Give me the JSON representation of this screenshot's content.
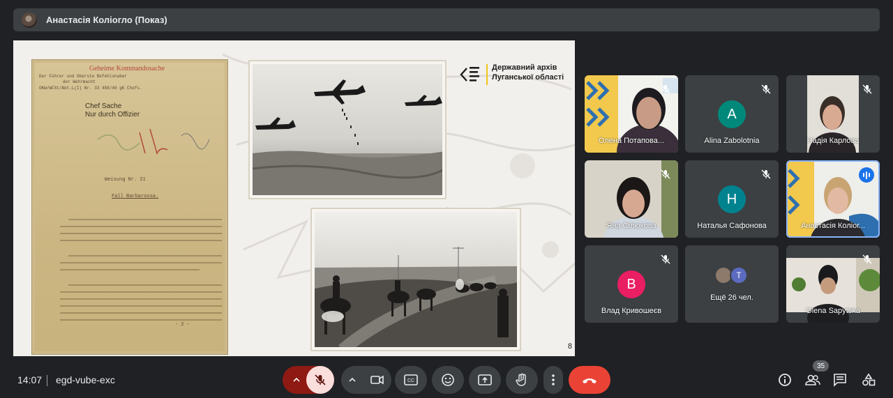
{
  "presenter": {
    "name": "Анастасія Коліогло (Показ)"
  },
  "slide": {
    "logo_line1": "Державний архів",
    "logo_line2": "Луганської області",
    "page_number": "8",
    "doc": {
      "stamp": "Geheime Kommandosache",
      "header_lines": [
        "Der Führer und Oberste Befehlshaber",
        "der Wehrmacht",
        "OKW/WFSt/Abt.L(I) Nr. 33 408/40 gK Chefs."
      ],
      "chef_line1": "Chef Sache",
      "chef_line2": "Nur durch Offizier",
      "weisung": "Weisung Nr. 21",
      "fall": "Fall Barbarossa.",
      "page": "- 2 -"
    }
  },
  "participants": [
    {
      "name": "Олена Потапова...",
      "letter": "",
      "muted": true,
      "kind": "video"
    },
    {
      "name": "Alina Zabolotnia",
      "letter": "A",
      "color": "#00897b",
      "muted": true,
      "kind": "avatar"
    },
    {
      "name": "Надія Карлова",
      "letter": "",
      "muted": true,
      "kind": "video"
    },
    {
      "name": "Яна Сілюкова",
      "letter": "",
      "muted": true,
      "kind": "video"
    },
    {
      "name": "Наталья Сафонова",
      "letter": "Н",
      "color": "#00838f",
      "muted": true,
      "kind": "avatar"
    },
    {
      "name": "Анастасія Коліог...",
      "letter": "",
      "muted": false,
      "kind": "video"
    },
    {
      "name": "Влад Кривошеєв",
      "letter": "В",
      "color": "#e91e63",
      "muted": true,
      "kind": "avatar"
    },
    {
      "name": "Ещё 26 чел.",
      "letter": "T",
      "color": "#5c6bc0",
      "muted": false,
      "kind": "more"
    },
    {
      "name": "Olena Sapytska",
      "letter": "",
      "muted": true,
      "kind": "video"
    }
  ],
  "bottom": {
    "time": "14:07",
    "meeting_code": "egd-vube-exc",
    "people_count": "35"
  },
  "colors": {
    "end_call": "#ea4335",
    "mic_off_bg": "#f9dedc",
    "mic_group": "#8e1a13",
    "accent": "#1a73e8"
  }
}
